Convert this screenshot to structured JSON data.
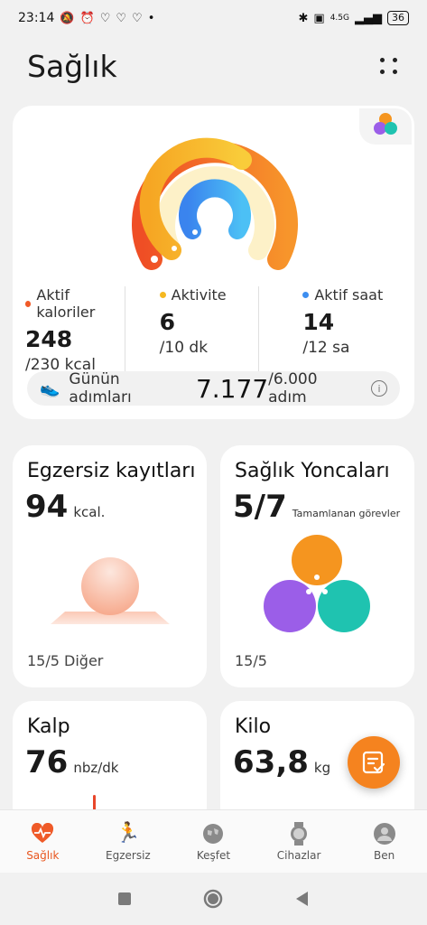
{
  "status": {
    "time": "23:14",
    "network": "4.5G",
    "battery": "36"
  },
  "header": {
    "title": "Sağlık"
  },
  "summary": {
    "metrics": [
      {
        "label": "Aktif kaloriler",
        "value": "248",
        "goal": "/230 kcal",
        "color": "#f05a28"
      },
      {
        "label": "Aktivite",
        "value": "6",
        "goal": "/10 dk",
        "color": "#f5b820"
      },
      {
        "label": "Aktif saat",
        "value": "14",
        "goal": "/12 sa",
        "color": "#3d8ef0"
      }
    ],
    "steps": {
      "label": "Günün adımları",
      "value": "7.177",
      "goal": "/6.000 adım"
    },
    "ring_progress": {
      "calories": 1.0,
      "activity": 0.6,
      "active_hours": 1.0
    }
  },
  "exercise": {
    "title": "Egzersiz kayıtları",
    "value": "94",
    "unit": "kcal.",
    "footer": "15/5 Diğer"
  },
  "clover": {
    "title": "Sağlık Yoncaları",
    "value": "5/7",
    "subtitle": "Tamamlanan görevler",
    "footer": "15/5"
  },
  "heart": {
    "title": "Kalp",
    "value": "76",
    "unit": "nbz/dk"
  },
  "weight": {
    "title": "Kilo",
    "value": "63,8",
    "unit": "kg"
  },
  "nav": [
    {
      "label": "Sağlık",
      "icon": "heart-pulse-icon",
      "active": true
    },
    {
      "label": "Egzersiz",
      "icon": "running-icon",
      "active": false
    },
    {
      "label": "Keşfet",
      "icon": "globe-icon",
      "active": false
    },
    {
      "label": "Cihazlar",
      "icon": "watch-icon",
      "active": false
    },
    {
      "label": "Ben",
      "icon": "person-icon",
      "active": false
    }
  ],
  "colors": {
    "accent": "#f5831f",
    "calories": "#f05a28",
    "activity": "#f5b820",
    "hours": "#3d8ef0"
  }
}
